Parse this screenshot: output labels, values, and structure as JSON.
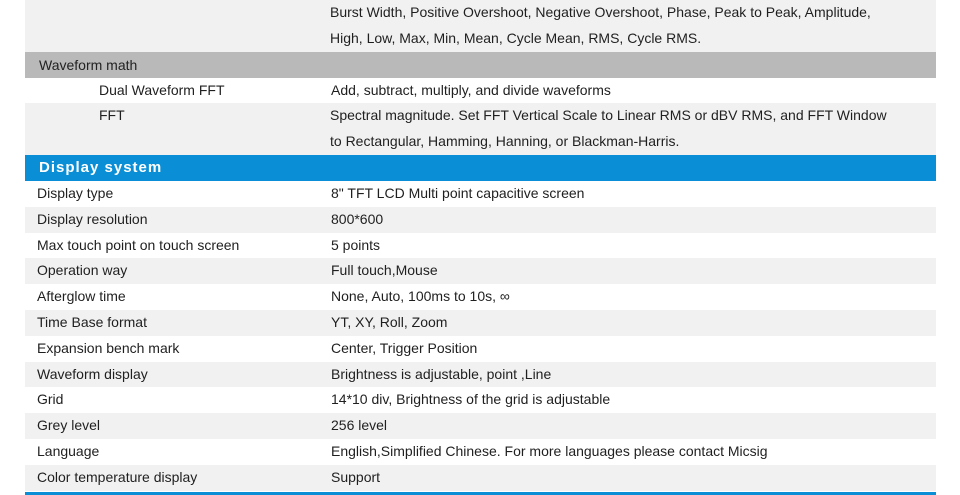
{
  "top_block": {
    "line1": "Burst Width, Positive Overshoot, Negative Overshoot, Phase, Peak to Peak, Amplitude,",
    "line2": "High, Low, Max, Min, Mean, Cycle Mean, RMS, Cycle RMS."
  },
  "waveform_math": {
    "header": "Waveform math",
    "dual_fft_label": "Dual Waveform FFT",
    "dual_fft_value": "Add, subtract, multiply, and divide waveforms",
    "fft_label": "FFT",
    "fft_value_line1": "Spectral magnitude. Set FFT Vertical Scale to Linear RMS or dBV RMS, and FFT Window",
    "fft_value_line2": "to Rectangular, Hamming, Hanning, or Blackman-Harris."
  },
  "display_system": {
    "header": "Display system",
    "rows": [
      {
        "label": "Display type",
        "value": "8ʺ  TFT LCD Multi point capacitive screen"
      },
      {
        "label": "Display resolution",
        "value": "800*600"
      },
      {
        "label": "Max touch point on touch screen",
        "value": "5 points"
      },
      {
        "label": "Operation way",
        "value": "Full touch,Mouse"
      },
      {
        "label": "Afterglow time",
        "value": "None, Auto, 100ms to 10s, ∞"
      },
      {
        "label": "Time Base format",
        "value": "YT, XY, Roll, Zoom"
      },
      {
        "label": "Expansion bench mark",
        "value": "Center, Trigger Position"
      },
      {
        "label": "Waveform display",
        "value": "Brightness is adjustable, point ,Line"
      },
      {
        "label": "Grid",
        "value": "14*10 div, Brightness of the grid is adjustable"
      },
      {
        "label": "Grey level",
        "value": "256 level"
      },
      {
        "label": "Language",
        "value": "English,Simplified Chinese. For more languages please contact Micsig"
      },
      {
        "label": "Color temperature display",
        "value": "Support"
      }
    ]
  },
  "colors": {
    "section_blue": "#0a8fd6",
    "group_gray": "#b9b9b9",
    "row_shade": "#f1f1f1"
  }
}
